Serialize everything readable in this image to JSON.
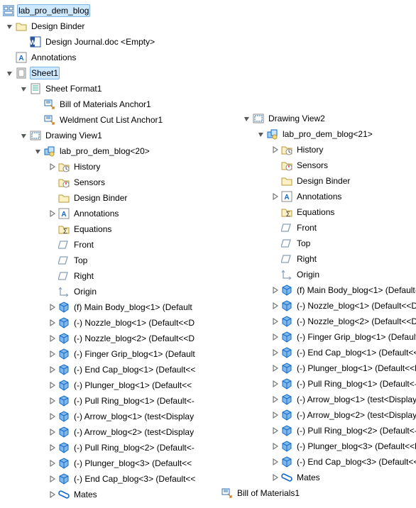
{
  "root": {
    "label": "lab_pro_dem_blog",
    "design_binder": "Design Binder",
    "design_journal": "Design Journal.doc <Empty>",
    "annotations": "Annotations",
    "sheet": "Sheet1",
    "sheet_format": "Sheet Format1",
    "bom_anchor": "Bill of Materials Anchor1",
    "weldment_anchor": "Weldment Cut List Anchor1",
    "view1": {
      "label": "Drawing View1",
      "asm": "lab_pro_dem_blog<20>",
      "history": "History",
      "sensors": "Sensors",
      "design_binder": "Design Binder",
      "annotations": "Annotations",
      "equations": "Equations",
      "front": "Front",
      "top": "Top",
      "right": "Right",
      "origin": "Origin",
      "parts": [
        "(f) Main Body_blog<1> (Default",
        "(-) Nozzle_blog<1> (Default<<D",
        "(-) Nozzle_blog<2> (Default<<D",
        "(-) Finger Grip_blog<1> (Default",
        "(-) End Cap_blog<1> (Default<<",
        "(-) Plunger_blog<1> (Default<<",
        "(-) Pull Ring_blog<1> (Default<-",
        "(-) Arrow_blog<1> (test<Display",
        "(-) Arrow_blog<2> (test<Display",
        "(-) Pull Ring_blog<2> (Default<-",
        "(-) Plunger_blog<3> (Default<<",
        "(-) End Cap_blog<3> (Default<<"
      ],
      "mates": "Mates"
    },
    "view2": {
      "label": "Drawing View2",
      "asm": "lab_pro_dem_blog<21>",
      "history": "History",
      "sensors": "Sensors",
      "design_binder": "Design Binder",
      "annotations": "Annotations",
      "equations": "Equations",
      "front": "Front",
      "top": "Top",
      "right": "Right",
      "origin": "Origin",
      "parts": [
        "(f) Main Body_blog<1> (Default-",
        "(-) Nozzle_blog<1> (Default<<D",
        "(-) Nozzle_blog<2> (Default<<D",
        "(-) Finger Grip_blog<1> (Default",
        "(-) End Cap_blog<1> (Default<<",
        "(-) Plunger_blog<1> (Default<<l",
        "(-) Pull Ring_blog<1> (Default<-",
        "(-) Arrow_blog<1> (test<Display",
        "(-) Arrow_blog<2> (test<Display",
        "(-) Pull Ring_blog<2> (Default<-",
        "(-) Plunger_blog<3> (Default<<l",
        "(-) End Cap_blog<3> (Default<<"
      ],
      "mates": "Mates"
    },
    "bom": "Bill of Materials1"
  }
}
